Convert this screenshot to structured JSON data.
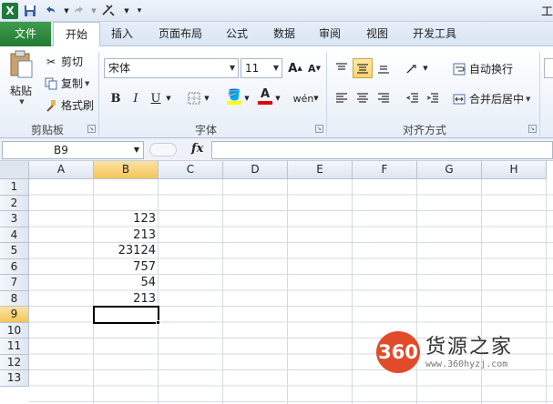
{
  "app": {
    "title_fragment": "工"
  },
  "qat": {
    "logo": "X",
    "save_icon": "save-icon",
    "undo_icon": "undo-icon",
    "redo_icon": "redo-icon",
    "customize_icon": "customize-icon"
  },
  "tabs": [
    {
      "label": "文件"
    },
    {
      "label": "开始"
    },
    {
      "label": "插入"
    },
    {
      "label": "页面布局"
    },
    {
      "label": "公式"
    },
    {
      "label": "数据"
    },
    {
      "label": "审阅"
    },
    {
      "label": "视图"
    },
    {
      "label": "开发工具"
    }
  ],
  "clipboard": {
    "paste": "粘贴",
    "cut": "剪切",
    "copy": "复制",
    "format_painter": "格式刷",
    "group": "剪贴板"
  },
  "font": {
    "name": "宋体",
    "size": "11",
    "bold": "B",
    "italic": "I",
    "underline": "U",
    "phonetic": "wén",
    "group": "字体",
    "grow": "A",
    "shrink": "A"
  },
  "alignment": {
    "wrap": "自动换行",
    "merge": "合并后居中",
    "group": "对齐方式"
  },
  "formula_bar": {
    "name_box": "B9",
    "fx": "fx",
    "content": ""
  },
  "columns": [
    "A",
    "B",
    "C",
    "D",
    "E",
    "F",
    "G",
    "H"
  ],
  "rows": [
    "1",
    "2",
    "3",
    "4",
    "5",
    "6",
    "7",
    "8",
    "9",
    "10",
    "11",
    "12",
    "13"
  ],
  "cells": [
    {
      "ref": "B3",
      "value": "123"
    },
    {
      "ref": "B4",
      "value": "213"
    },
    {
      "ref": "B5",
      "value": "23124"
    },
    {
      "ref": "B6",
      "value": "757"
    },
    {
      "ref": "B7",
      "value": "54"
    },
    {
      "ref": "B8",
      "value": "213"
    }
  ],
  "selection": {
    "cell": "B9",
    "column": "B",
    "row": "9"
  },
  "watermark": {
    "logo": "360",
    "name": "货源之家",
    "url": "www.360hyzj.com"
  }
}
